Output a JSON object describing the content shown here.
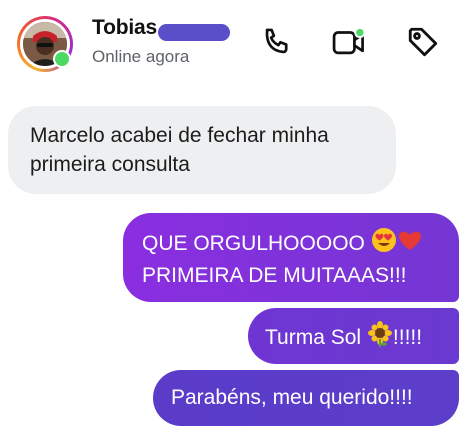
{
  "header": {
    "contact_name": "Tobias",
    "presence_status": "Online agora"
  },
  "icons": {
    "call": "phone-icon",
    "video": "video-camera-icon",
    "tag": "tag-icon"
  },
  "colors": {
    "online_green": "#4cd964",
    "outgoing_purple": "#7b2fd6",
    "incoming_gray": "#eeeff1",
    "redaction": "#5b4ec9"
  },
  "messages": [
    {
      "direction": "incoming",
      "lines": [
        "Marcelo acabei de fechar minha",
        "primeira consulta"
      ]
    },
    {
      "direction": "outgoing",
      "lines": [
        "QUE ORGULHOOOOO",
        "PRIMEIRA DE MUITAAAS!!!"
      ]
    },
    {
      "direction": "outgoing",
      "text_before": "Turma Sol ",
      "text_after": "!!!!!"
    },
    {
      "direction": "outgoing",
      "text": "Parabéns, meu querido!!!!"
    }
  ]
}
